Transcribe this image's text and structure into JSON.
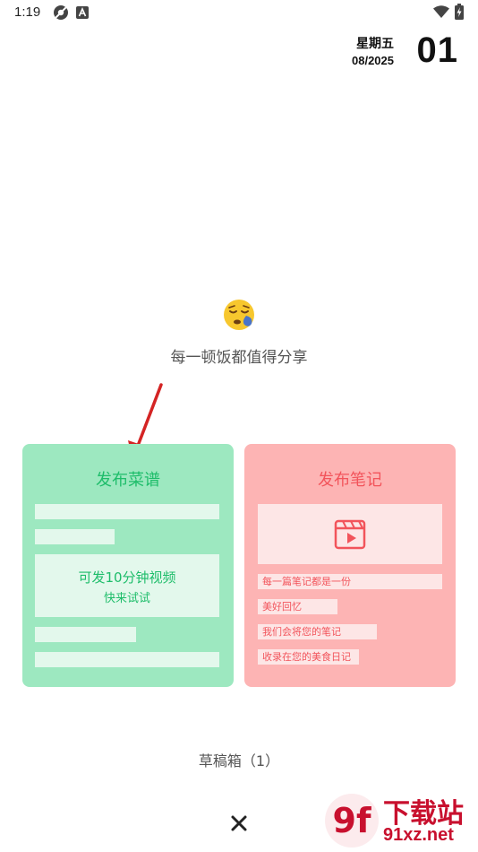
{
  "status_bar": {
    "time": "1:19"
  },
  "date": {
    "weekday": "星期五",
    "month_year": "08/2025",
    "day": "01"
  },
  "tagline": "每一顿饭都值得分享",
  "recipe_card": {
    "title": "发布菜谱",
    "video_line1": "可发10分钟视频",
    "video_line2": "快来试试",
    "color": "#1ebd6a",
    "background": "#9de8c0"
  },
  "note_card": {
    "title": "发布笔记",
    "lines": [
      "每一篇笔记都是一份",
      "美好回忆",
      "我们会将您的笔记",
      "收录在您的美食日记"
    ],
    "color": "#f2545b",
    "background": "#fdb4b4"
  },
  "drafts": {
    "label": "草稿箱（1）"
  },
  "watermark": {
    "line1": "下载站",
    "line2": "91xz.net",
    "logo": "9f"
  },
  "icons": {
    "emoji": "sleepy-face-icon",
    "video": "video-clapper-icon",
    "close": "close-icon"
  }
}
